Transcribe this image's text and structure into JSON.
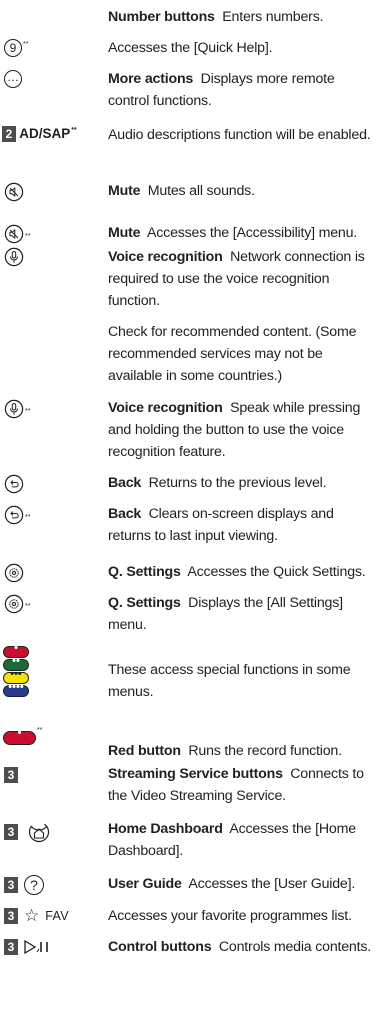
{
  "rows": [
    {
      "bold": "Number buttons",
      "text": "Enters numbers."
    },
    {
      "icon": "9",
      "sup": "**",
      "bold": "",
      "text": "Accesses the [Quick Help]."
    },
    {
      "icon": "…",
      "bold": "More actions",
      "text": "Displays more remote control functions."
    },
    {
      "badge": "2",
      "label": "AD/SAP",
      "sup": "**",
      "bold": "",
      "text": "Audio descriptions function will be enabled."
    },
    {
      "icon": "mute",
      "bold": "Mute",
      "text": "Mutes all sounds."
    },
    {
      "icon": "mute",
      "sup": "**",
      "bold": "Mute",
      "text": "Accesses the [Accessibility] menu."
    },
    {
      "icon": "mic",
      "bold": "Voice recognition",
      "text": "Network connection is required to use the voice recognition function."
    },
    {
      "bold": "",
      "text": "Check for recommended content. (Some recommended services may not be available in some countries.)"
    },
    {
      "icon": "mic",
      "sup": "**",
      "bold": "Voice recognition",
      "text": "Speak while pressing and holding the button to use the voice recognition feature."
    },
    {
      "icon": "back",
      "bold": "Back",
      "text": "Returns to the previous level."
    },
    {
      "icon": "back",
      "sup": "**",
      "bold": "Back",
      "text": "Clears on-screen displays and returns to last input viewing."
    },
    {
      "icon": "gear",
      "bold": "Q. Settings",
      "text": "Accesses the Quick Settings."
    },
    {
      "icon": "gear",
      "sup": "**",
      "bold": "Q. Settings",
      "text": "Displays the [All Settings] menu."
    },
    {
      "bold": "",
      "text": "These access special functions in some menus."
    },
    {
      "sup": "**",
      "bold": "Red button",
      "text": "Runs the record function."
    },
    {
      "badge": "3",
      "bold": "Streaming Service buttons",
      "text": "Connects to the Video Streaming Service."
    },
    {
      "badge": "3",
      "bold": "Home Dashboard",
      "text": "Accesses the [Home Dashboard]."
    },
    {
      "badge": "3",
      "bold": "User Guide",
      "text": "Accesses the [User Guide]."
    },
    {
      "badge": "3",
      "label": "FAV",
      "bold": "",
      "text": "Accesses your favorite programmes list."
    },
    {
      "badge": "3",
      "bold": "Control buttons",
      "text": "Controls media contents."
    }
  ],
  "colors": {
    "red": "#c8102e",
    "green": "#1e6b3a",
    "yellow": "#f2e600",
    "blue": "#2a3c8f",
    "badge": "#4d4d4f"
  }
}
